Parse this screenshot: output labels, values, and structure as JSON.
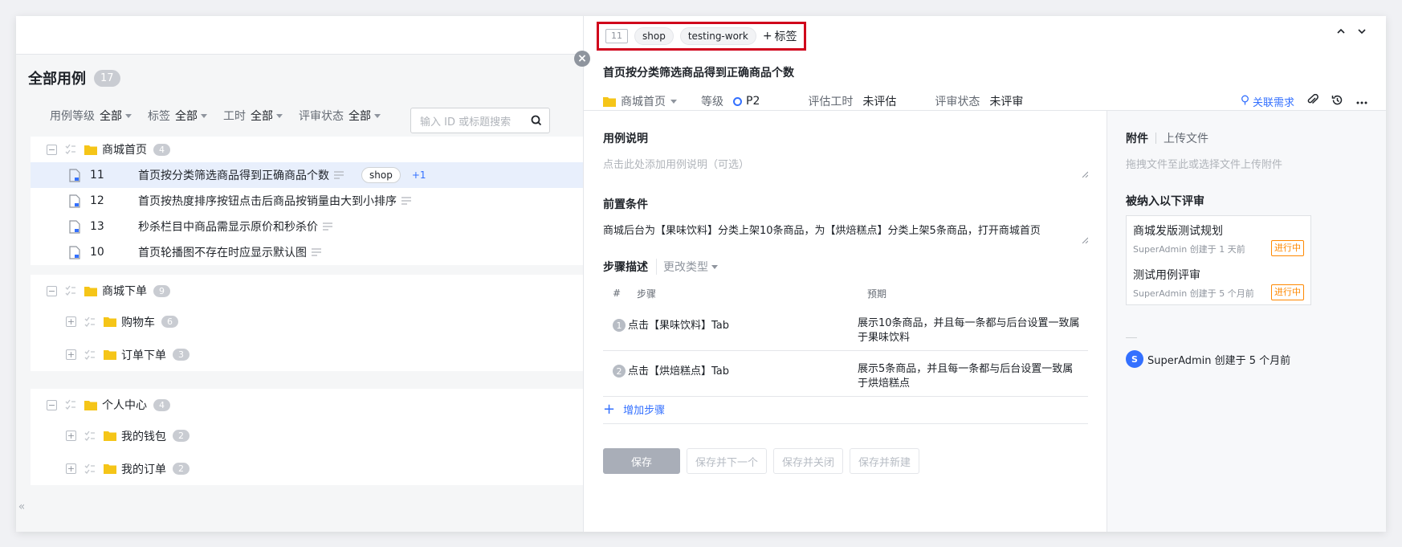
{
  "left": {
    "title": "全部用例",
    "total_count": "17",
    "filters": [
      {
        "label": "用例等级",
        "value": "全部"
      },
      {
        "label": "标签",
        "value": "全部"
      },
      {
        "label": "工时",
        "value": "全部"
      },
      {
        "label": "评审状态",
        "value": "全部"
      }
    ],
    "search_placeholder": "输入 ID 或标题搜索",
    "groups": [
      {
        "name": "商城首页",
        "count": "4",
        "cases": [
          {
            "id": "11",
            "title": "首页按分类筛选商品得到正确商品个数",
            "tag": "shop",
            "more": "+1"
          },
          {
            "id": "12",
            "title": "首页按热度排序按钮点击后商品按销量由大到小排序"
          },
          {
            "id": "13",
            "title": "秒杀栏目中商品需显示原价和秒杀价"
          },
          {
            "id": "10",
            "title": "首页轮播图不存在时应显示默认图"
          }
        ]
      },
      {
        "name": "商城下单",
        "count": "9",
        "children": [
          {
            "name": "购物车",
            "count": "6"
          },
          {
            "name": "订单下单",
            "count": "3"
          }
        ]
      },
      {
        "name": "个人中心",
        "count": "4",
        "children": [
          {
            "name": "我的钱包",
            "count": "2"
          },
          {
            "name": "我的订单",
            "count": "2"
          }
        ]
      }
    ],
    "collapse_glyph": "«"
  },
  "detail": {
    "id": "11",
    "tags": [
      "shop",
      "testing-work"
    ],
    "add_tag": "标签",
    "title": "首页按分类筛选商品得到正确商品个数",
    "module": "商城首页",
    "priority_label": "等级",
    "priority": "P2",
    "estimate_label": "评估工时",
    "estimate": "未评估",
    "review_label": "评审状态",
    "review": "未评审",
    "link_req": "关联需求",
    "desc_title": "用例说明",
    "desc_placeholder": "点击此处添加用例说明（可选）",
    "precondition_title": "前置条件",
    "precondition": "商城后台为【果味饮料】分类上架10条商品，为【烘焙糕点】分类上架5条商品，打开商城首页",
    "steps_title": "步骤描述",
    "change_type": "更改类型",
    "steps_header": {
      "num": "#",
      "step": "步骤",
      "expect": "预期"
    },
    "steps": [
      {
        "num": "1",
        "step": "点击【果味饮料】Tab",
        "expect": "展示10条商品，并且每一条都与后台设置一致属于果味饮料"
      },
      {
        "num": "2",
        "step": "点击【烘焙糕点】Tab",
        "expect": "展示5条商品，并且每一条都与后台设置一致属于烘焙糕点"
      }
    ],
    "add_step": "增加步骤",
    "buttons": {
      "save": "保存",
      "save_next": "保存并下一个",
      "save_close": "保存并关闭",
      "save_new": "保存并新建"
    },
    "side": {
      "tab_attach": "附件",
      "tab_upload": "上传文件",
      "drop_hint": "拖拽文件至此或选择文件上传附件",
      "reviews_title": "被纳入以下评审",
      "reviews": [
        {
          "name": "商城发版测试规划",
          "meta": "SuperAdmin 创建于 1 天前",
          "status": "进行中"
        },
        {
          "name": "测试用例评审",
          "meta": "SuperAdmin 创建于 5 个月前",
          "status": "进行中"
        }
      ],
      "creator_initial": "S",
      "creator": "SuperAdmin 创建于 5 个月前"
    }
  },
  "colors": {
    "accent": "#3370ff",
    "highlight_border": "#d0021b",
    "folder": "#f5c518",
    "status": "#ff8800"
  }
}
